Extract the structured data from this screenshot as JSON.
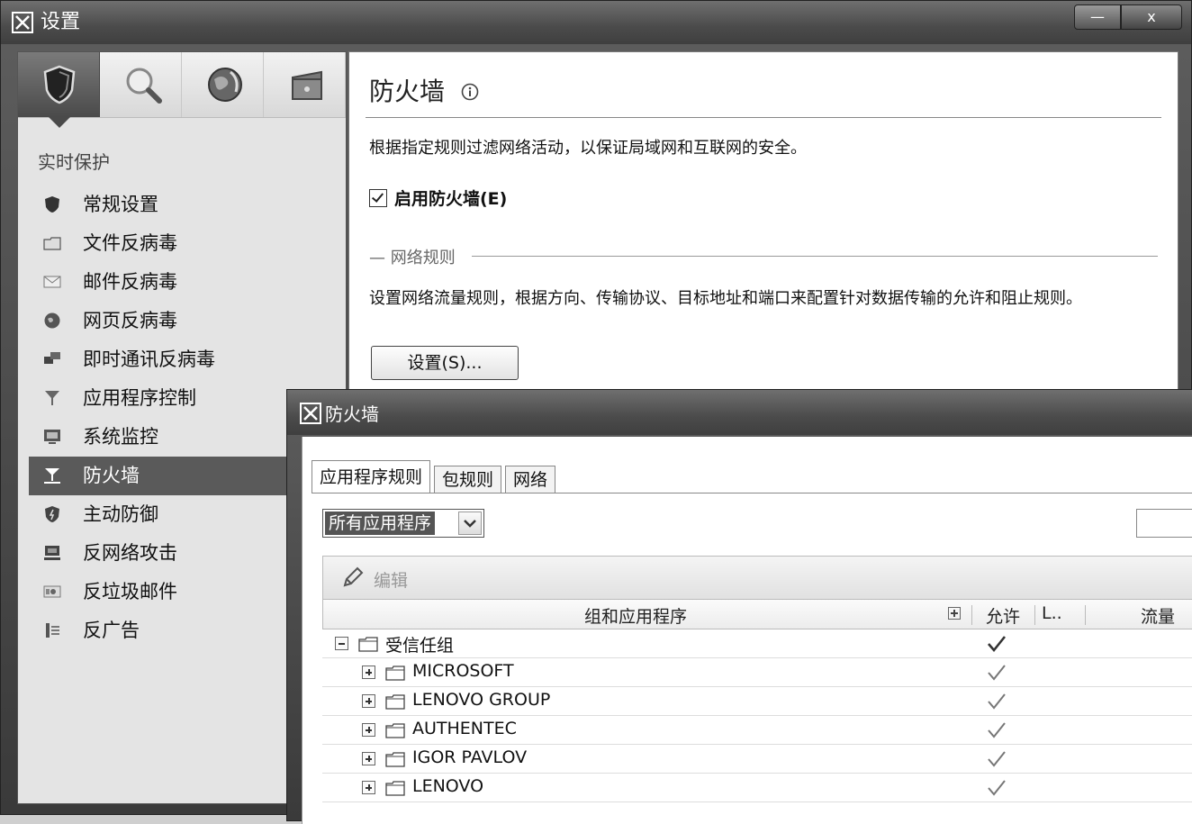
{
  "main_window": {
    "title": "设置",
    "minimize_label": "—",
    "close_label": "x"
  },
  "sidebar": {
    "icon_tabs": [
      "shield-icon",
      "magnifier-icon",
      "globe-icon",
      "toolbox-icon"
    ],
    "section_title": "实时保护",
    "items": [
      {
        "label": "常规设置",
        "icon": "shield-icon"
      },
      {
        "label": "文件反病毒",
        "icon": "folder-icon"
      },
      {
        "label": "邮件反病毒",
        "icon": "envelope-icon"
      },
      {
        "label": "网页反病毒",
        "icon": "globe-icon"
      },
      {
        "label": "即时通讯反病毒",
        "icon": "chat-icon"
      },
      {
        "label": "应用程序控制",
        "icon": "funnel-icon"
      },
      {
        "label": "系统监控",
        "icon": "monitor-icon"
      },
      {
        "label": "防火墙",
        "icon": "firewall-icon",
        "selected": true
      },
      {
        "label": "主动防御",
        "icon": "proactive-shield-icon"
      },
      {
        "label": "反网络攻击",
        "icon": "network-attack-icon"
      },
      {
        "label": "反垃圾邮件",
        "icon": "spam-icon"
      },
      {
        "label": "反广告",
        "icon": "anti-banner-icon"
      }
    ]
  },
  "content": {
    "title": "防火墙",
    "description": "根据指定规则过滤网络活动，以保证局域网和互联网的安全。",
    "enable_checkbox_label": "启用防火墙(E)",
    "enable_checked": true,
    "network_rules_legend": "— 网络规则",
    "network_rules_description": "设置网络流量规则，根据方向、传输协议、目标地址和端口来配置针对数据传输的允许和阻止规则。",
    "settings_button": "设置(S)..."
  },
  "firewall_window": {
    "title": "防火墙",
    "tabs": [
      {
        "label": "应用程序规则",
        "active": true
      },
      {
        "label": "包规则",
        "active": false
      },
      {
        "label": "网络",
        "active": false
      }
    ],
    "filter_selected": "所有应用程序",
    "toolbar": {
      "edit_label": "编辑"
    },
    "columns": {
      "name": "组和应用程序",
      "allow": "允许",
      "col3": "L..",
      "traffic": "流量"
    },
    "rows": [
      {
        "label": "受信任组",
        "level": 0,
        "expanded": true,
        "allowed": true
      },
      {
        "label": "MICROSOFT",
        "level": 1,
        "expanded": false,
        "allowed": true
      },
      {
        "label": "LENOVO GROUP",
        "level": 1,
        "expanded": false,
        "allowed": true
      },
      {
        "label": "AUTHENTEC",
        "level": 1,
        "expanded": false,
        "allowed": true
      },
      {
        "label": "IGOR PAVLOV",
        "level": 1,
        "expanded": false,
        "allowed": true
      },
      {
        "label": "LENOVO",
        "level": 1,
        "expanded": false,
        "allowed": true
      }
    ]
  }
}
